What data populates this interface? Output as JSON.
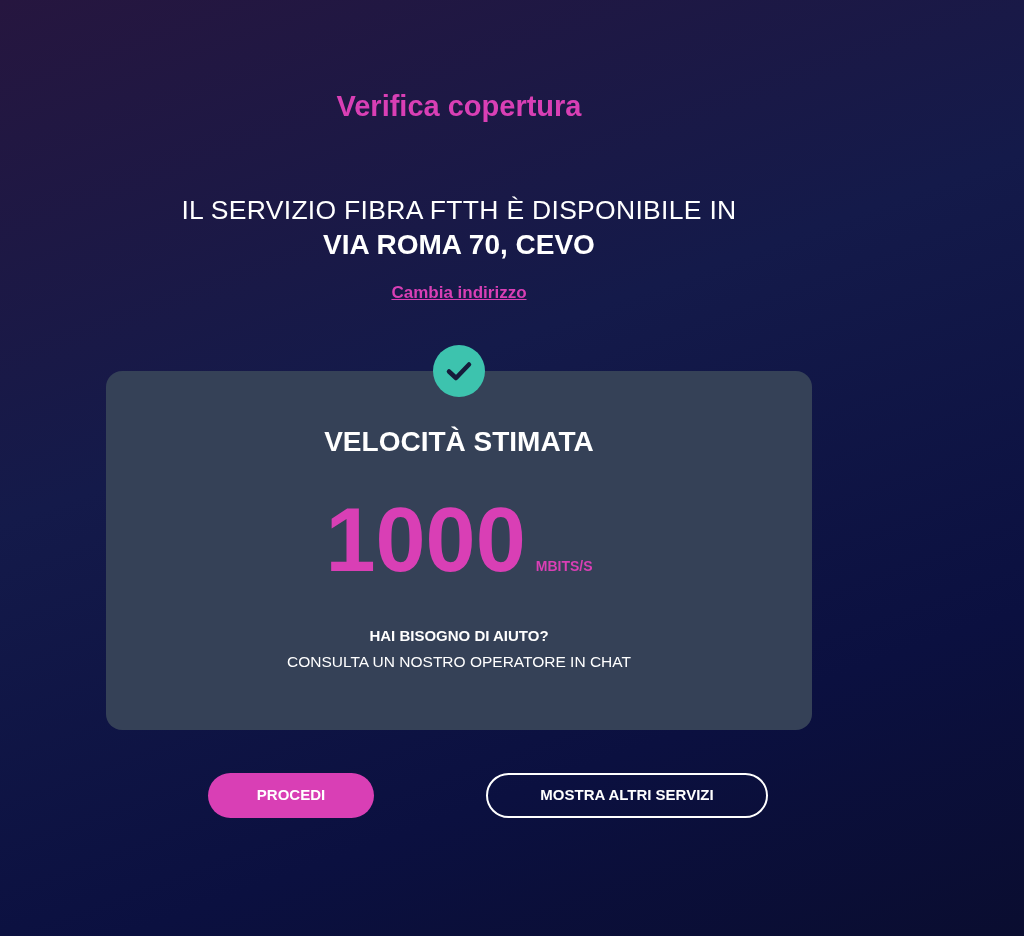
{
  "heading": "Verifica copertura",
  "availability": {
    "text": "IL SERVIZIO FIBRA FTTH È DISPONIBILE IN",
    "address": "VIA ROMA 70, CEVO"
  },
  "change_address_link": "Cambia indirizzo",
  "speed_card": {
    "title": "VELOCITÀ STIMATA",
    "speed": "1000",
    "unit": "MBITS/S",
    "help_title": "HAI BISOGNO DI AIUTO?",
    "help_text": "CONSULTA UN NOSTRO OPERATORE IN CHAT"
  },
  "buttons": [
    {
      "label": "PROCEDI",
      "kind": "primary"
    },
    {
      "label": "MOSTRA ALTRI SERVIZI",
      "kind": "outline"
    }
  ]
}
